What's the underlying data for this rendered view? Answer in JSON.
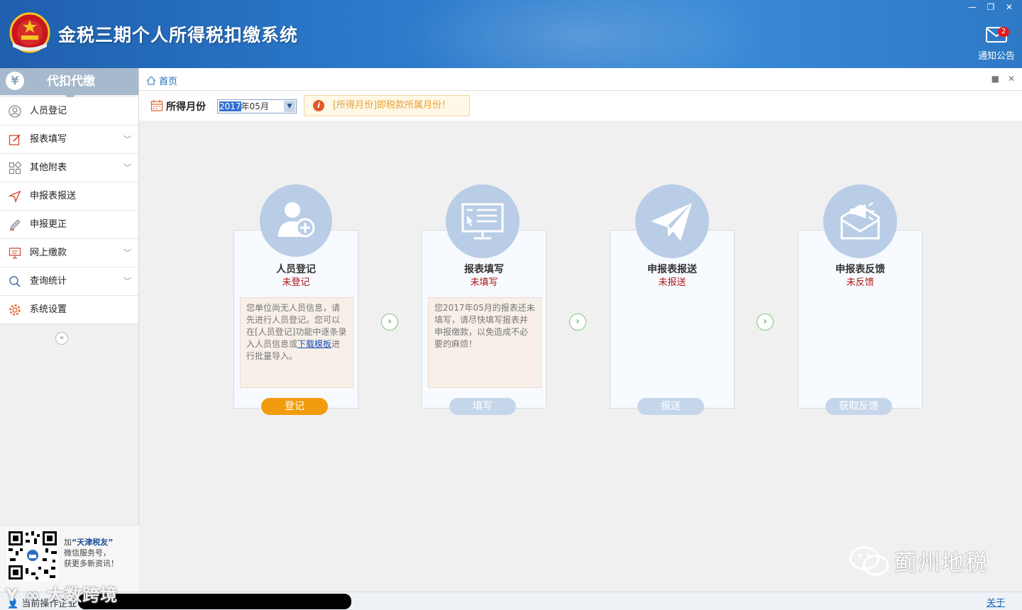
{
  "app": {
    "title": "金税三期个人所得税扣缴系统",
    "notify_label": "通知公告",
    "notify_count": "2"
  },
  "window_controls": [
    "minimize-icon",
    "restore-icon",
    "close-icon"
  ],
  "sidebar": {
    "header": "代扣代缴",
    "header_icon": "¥",
    "items": [
      {
        "label": "人员登记",
        "icon": "user-icon",
        "expandable": false
      },
      {
        "label": "报表填写",
        "icon": "edit-form-icon",
        "expandable": true
      },
      {
        "label": "其他附表",
        "icon": "grid-icon",
        "expandable": true
      },
      {
        "label": "申报表报送",
        "icon": "send-icon",
        "expandable": false
      },
      {
        "label": "申报更正",
        "icon": "pencil-icon",
        "expandable": false
      },
      {
        "label": "网上缴款",
        "icon": "monitor-icon",
        "expandable": true
      },
      {
        "label": "查询统计",
        "icon": "search-icon",
        "expandable": true
      },
      {
        "label": "系统设置",
        "icon": "gear-icon",
        "expandable": false
      }
    ],
    "collapse_glyph": "«",
    "qr_text": {
      "line1_prefix": "加",
      "brand": "“天津税友”",
      "line2": "微信服务号，",
      "line3": "获更多新资讯！"
    }
  },
  "tabbar": {
    "home_label": "首页"
  },
  "filter": {
    "label": "所得月份",
    "year_selected": "2017",
    "month_rest": "年05月",
    "hint": "[所得月份]即税款所属月份！"
  },
  "cards": [
    {
      "title": "人员登记",
      "status": "未登记",
      "desc_a": "您单位尚无人员信息，请先进行人员登记。您可以在[人员登记]功能中逐条录入人员信息或",
      "desc_link": "下载模板",
      "desc_b": "进行批量导入。",
      "button": "登记",
      "active": true
    },
    {
      "title": "报表填写",
      "status": "未填写",
      "desc_a": "您2017年05月的报表还未填写，请尽快填写报表并申报缴款，以免造成不必要的麻烦！",
      "desc_link": "",
      "desc_b": "",
      "button": "填写",
      "active": false
    },
    {
      "title": "申报表报送",
      "status": "未报送",
      "button": "报送",
      "active": false
    },
    {
      "title": "申报表反馈",
      "status": "未反馈",
      "button": "获取反馈",
      "active": false
    }
  ],
  "statusbar": {
    "left": "当前操作企业",
    "about": "关于"
  },
  "watermarks": {
    "left": "大数跨境",
    "right": "蓟州地税"
  },
  "colors": {
    "header": "#2b78c9",
    "accent_orange": "#f19c0c",
    "status_red": "#b01818",
    "circle": "#b9cde6",
    "link": "#1566c0"
  }
}
